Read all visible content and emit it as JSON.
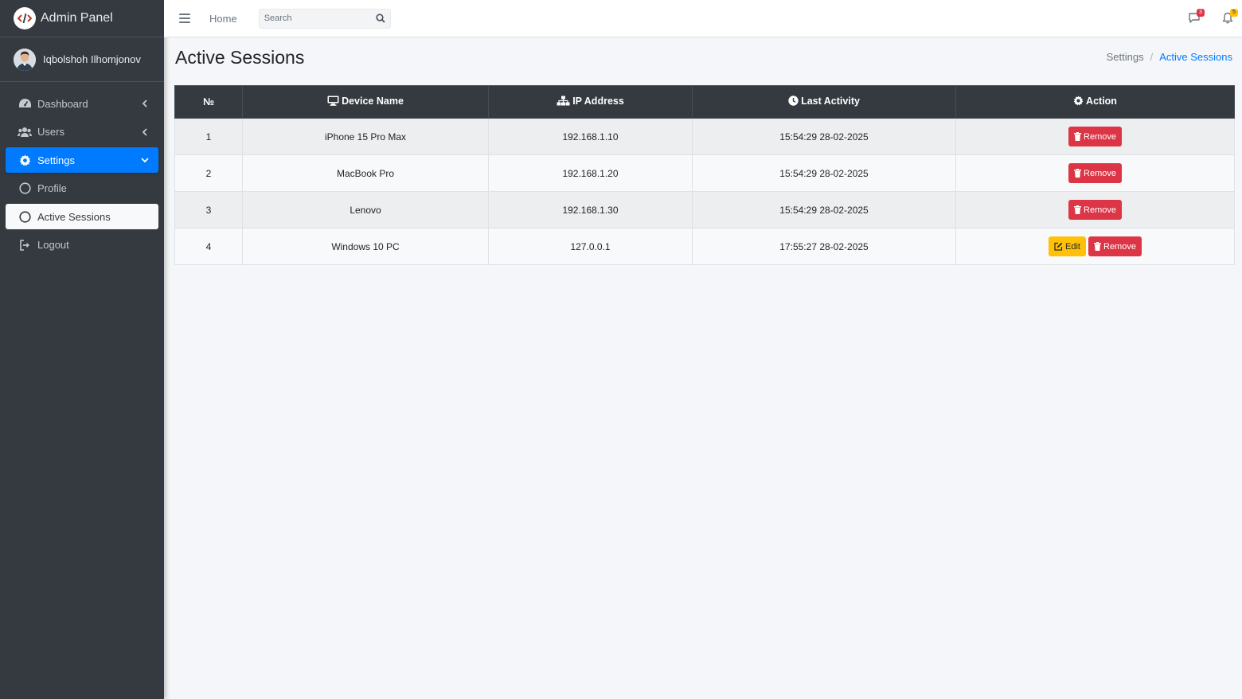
{
  "brand": {
    "title": "Admin Panel",
    "logo_icon": "code-logo-icon"
  },
  "user": {
    "name": "Iqbolshoh Ilhomjonov"
  },
  "sidebar": {
    "items": [
      {
        "label": "Dashboard",
        "icon": "tachometer-icon"
      },
      {
        "label": "Users",
        "icon": "users-icon"
      },
      {
        "label": "Settings",
        "icon": "gear-icon"
      },
      {
        "label": "Profile",
        "icon": "circle-icon"
      },
      {
        "label": "Active Sessions",
        "icon": "circle-icon"
      },
      {
        "label": "Logout",
        "icon": "logout-icon"
      }
    ]
  },
  "topbar": {
    "home_label": "Home",
    "search_placeholder": "Search",
    "messages_badge": "3",
    "notifications_badge": "5"
  },
  "page": {
    "title": "Active Sessions",
    "breadcrumb": [
      "Settings",
      "Active Sessions"
    ]
  },
  "table": {
    "headers": [
      "№",
      "Device Name",
      "IP Address",
      "Last Activity",
      "Action"
    ],
    "rows": [
      {
        "num": "1",
        "device": "iPhone 15 Pro Max",
        "ip": "192.168.1.10",
        "last": "15:54:29 28-02-2025"
      },
      {
        "num": "2",
        "device": "MacBook Pro",
        "ip": "192.168.1.20",
        "last": "15:54:29 28-02-2025"
      },
      {
        "num": "3",
        "device": "Lenovo",
        "ip": "192.168.1.30",
        "last": "15:54:29 28-02-2025"
      },
      {
        "num": "4",
        "device": "Windows 10 PC",
        "ip": "127.0.0.1",
        "last": "17:55:27 28-02-2025"
      }
    ],
    "edit_label": "Edit",
    "remove_label": "Remove"
  },
  "colors": {
    "sidebar_bg": "#343a40",
    "primary": "#007bff",
    "danger": "#dc3545",
    "warning": "#ffc107"
  }
}
